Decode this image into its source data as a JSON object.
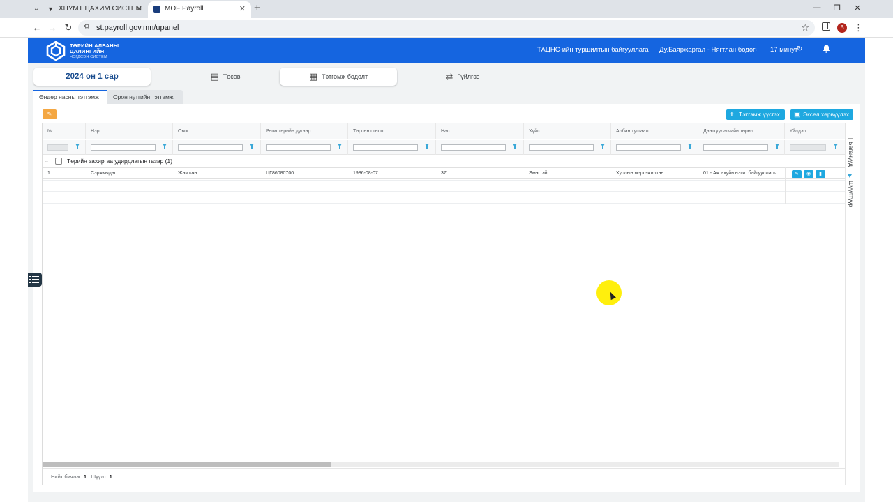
{
  "browser": {
    "tabs": [
      {
        "title": "ХНУМТ ЦАХИМ СИСТЕМ",
        "active": false
      },
      {
        "title": "MOF Payroll",
        "active": true
      }
    ],
    "url": "st.payroll.gov.mn/upanel",
    "profile_initial": "B"
  },
  "header": {
    "logo_line1": "ТӨРИЙН АЛБАНЫ",
    "logo_line2": "ЦАЛИНГИЙН",
    "logo_line3": "НЭГДСЭН СИСТЕМ",
    "org": "ТАЦНС-ийн туршилтын байгууллага",
    "user": "Ду.Баяржаргал - Нягтлан бодогч",
    "session": "17 минут"
  },
  "top_tabs": {
    "month": "2024 он 1 сар",
    "budget": "Төсөв",
    "calc": "Тэтгэмж бодолт",
    "transactions": "Гүйлгээ"
  },
  "sub_tabs": {
    "elder": "Өндөр насны тэтгэмж",
    "local": "Орон нутгийн тэтгэмж"
  },
  "toolbar": {
    "add_label": "Тэтгэмж үүсгэх",
    "excel_label": "Эксел хөрвүүлэх"
  },
  "grid": {
    "columns": [
      "№",
      "Нэр",
      "Овог",
      "Регистерийн дугаар",
      "Төрсөн огноо",
      "Нас",
      "Хүйс",
      "Албан тушаал",
      "Даатгуулагчийн төрөл",
      "Үйлдэл"
    ],
    "group_label": "Төрийн захиргаа удирдлагын газар (1)",
    "rows": [
      {
        "no": "1",
        "name": "Сэржмядаг",
        "surname": "Жамъян",
        "register": "ЦГ86080700",
        "birthdate": "1986-08-07",
        "age": "37",
        "gender": "Эмэгтэй",
        "position": "Хурлын мэргэжилтэн",
        "insured_type": "01 - Аж ахуйн нэгж, байгууллагы..."
      }
    ],
    "side_labels": [
      "Баганууд",
      "Шүүлтүүр"
    ],
    "footer_total_label": "Нийт бичлэг:",
    "footer_total": "1",
    "footer_filter_label": "Шүүлт:",
    "footer_filter": "1"
  },
  "colors": {
    "header_bg": "#1565e0",
    "accent_button": "#1ea8e0",
    "wand_button": "#f4a742"
  }
}
